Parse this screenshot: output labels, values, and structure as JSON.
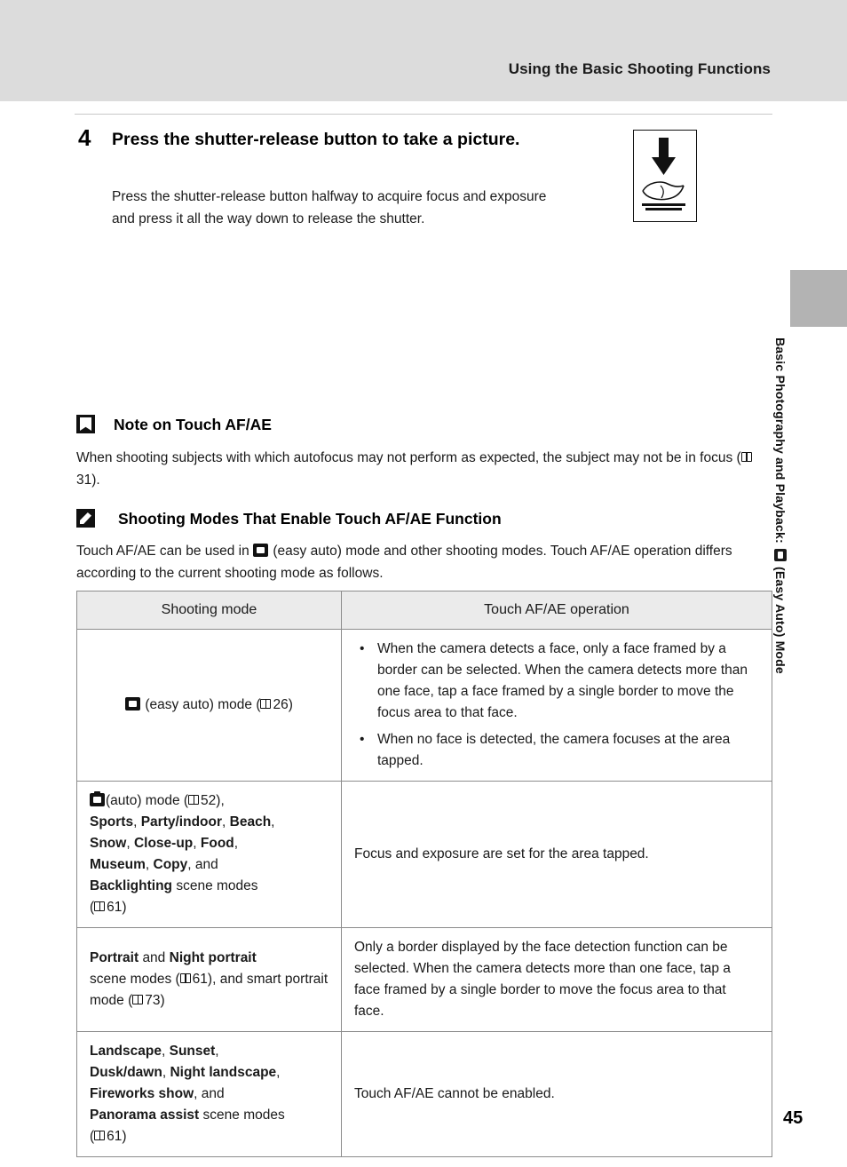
{
  "header": {
    "title": "Using the Basic Shooting Functions"
  },
  "side_tab": {
    "text_before_icon": "Basic Photography and Playback:",
    "icon": "easy-auto-mode-icon",
    "text_after_icon": "(Easy Auto) Mode"
  },
  "step": {
    "number": "4",
    "title": "Press the shutter-release button to take a picture.",
    "body": "Press the shutter-release button halfway to acquire focus and exposure and press it all the way down to release the shutter.",
    "illustration": "finger-pressing-shutter-button-illustration"
  },
  "note_touch": {
    "icon": "caution-icon",
    "heading": "Note on Touch AF/AE",
    "text_1": "When shooting subjects with which autofocus may not perform as expected, the subject may not be in focus (",
    "page_ref": "31",
    "text_2": ")."
  },
  "note_modes": {
    "icon": "pencil-note-icon",
    "heading": "Shooting Modes That Enable Touch AF/AE Function",
    "text_1": "Touch AF/AE can be used in",
    "icon_inline": "easy-auto-mode-icon",
    "text_2": "(easy auto) mode and other shooting modes. Touch AF/AE operation differs according to the current shooting mode as follows."
  },
  "table": {
    "headers": [
      "Shooting mode",
      "Touch AF/AE operation"
    ],
    "rows": [
      {
        "mode_icon": "easy-auto-mode-icon",
        "mode_text": "(easy auto) mode (",
        "mode_ref": "26",
        "mode_text_end": ")",
        "operation_bullets": [
          "When the camera detects a face, only a face framed by a border can be selected. When the camera detects more than one face, tap a face framed by a single border to move the focus area to that face.",
          "When no face is detected, the camera focuses at the area tapped."
        ]
      },
      {
        "mode_icon": "auto-mode-icon",
        "mode_line1_a": "(auto) mode (",
        "mode_line1_ref": "52",
        "mode_line1_b": "),",
        "mode_bold_1": "Sports",
        "mode_bold_2": "Party/indoor",
        "mode_bold_3": "Beach",
        "mode_bold_4": "Snow",
        "mode_bold_5": "Close-up",
        "mode_bold_6": "Food",
        "mode_bold_7": "Museum",
        "mode_bold_8": "Copy",
        "mode_and": "and",
        "mode_bold_9": "Backlighting",
        "mode_tail": "scene modes",
        "mode_ref_2": "61",
        "operation": "Focus and exposure are set for the area tapped."
      },
      {
        "mode_bold_1": "Portrait",
        "mode_and": "and",
        "mode_bold_2": "Night portrait",
        "mode_text_1": "scene modes (",
        "mode_ref_1": "61",
        "mode_text_2": "), and smart portrait mode (",
        "mode_ref_2": "73",
        "mode_text_3": ")",
        "operation": "Only a border displayed by the face detection function can be selected. When the camera detects more than one face, tap a face framed by a single border to move the focus area to that face."
      },
      {
        "mode_bold_1": "Landscape",
        "mode_bold_2": "Sunset",
        "mode_bold_3": "Dusk/dawn",
        "mode_bold_4": "Night landscape",
        "mode_bold_5": "Fireworks show",
        "mode_and": "and",
        "mode_bold_6": "Panorama assist",
        "mode_tail": "scene modes",
        "mode_ref": "61",
        "operation": "Touch AF/AE cannot be enabled."
      }
    ]
  },
  "page_number": "45"
}
